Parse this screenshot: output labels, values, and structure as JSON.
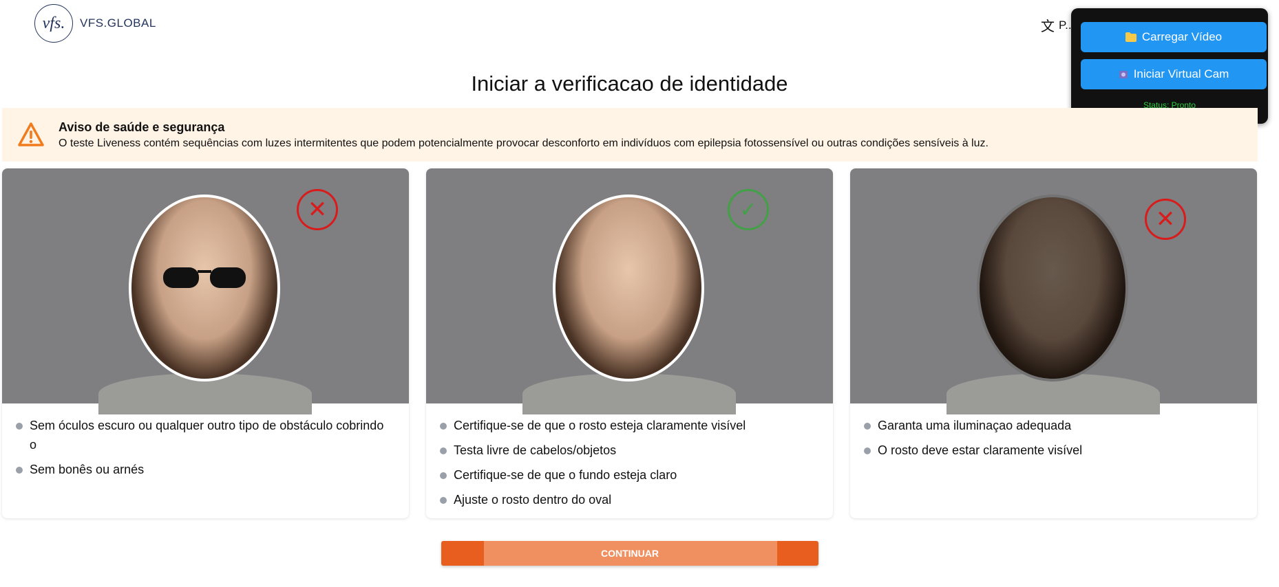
{
  "header": {
    "logo_mark": "vfs.",
    "logo_text": "VFS.GLOBAL",
    "language_icon": "translate-icon",
    "language_label": "P..."
  },
  "overlay": {
    "upload_button": "Carregar Vídeo",
    "upload_icon": "folder-icon",
    "virtualcam_button": "Iniciar Virtual Cam",
    "virtualcam_icon": "camera-icon",
    "status": "Status: Pronto"
  },
  "page_title": "Iniciar a verificacao de identidade",
  "warning": {
    "icon": "warning-icon",
    "title": "Aviso de saúde e segurança",
    "text": "O teste Liveness contém sequências com luzes intermitentes que podem potencialmente provocar desconforto em indivíduos com epilepsia fotossensível ou outras condições sensíveis à luz."
  },
  "cards": [
    {
      "status": "incorrect",
      "badge_icon": "x-circle-icon",
      "items": [
        "Sem óculos escuro ou qualquer outro tipo de obstáculo cobrindo o",
        "Sem bonês ou arnés"
      ]
    },
    {
      "status": "correct",
      "badge_icon": "check-circle-icon",
      "items": [
        "Certifique-se de que o rosto esteja claramente visível",
        "Testa livre de cabelos/objetos",
        "Certifique-se de que o fundo esteja claro",
        "Ajuste o rosto dentro do oval"
      ]
    },
    {
      "status": "incorrect",
      "badge_icon": "x-circle-icon",
      "items": [
        "Garanta uma iluminaçao adequada",
        "O rosto deve estar claramente visível"
      ]
    }
  ],
  "continue_button": "CONTINUAR",
  "colors": {
    "accent_orange": "#e85e1e",
    "warning_bg": "#fff4e6",
    "overlay_button": "#2196f3",
    "status_green": "#2ecc40"
  }
}
